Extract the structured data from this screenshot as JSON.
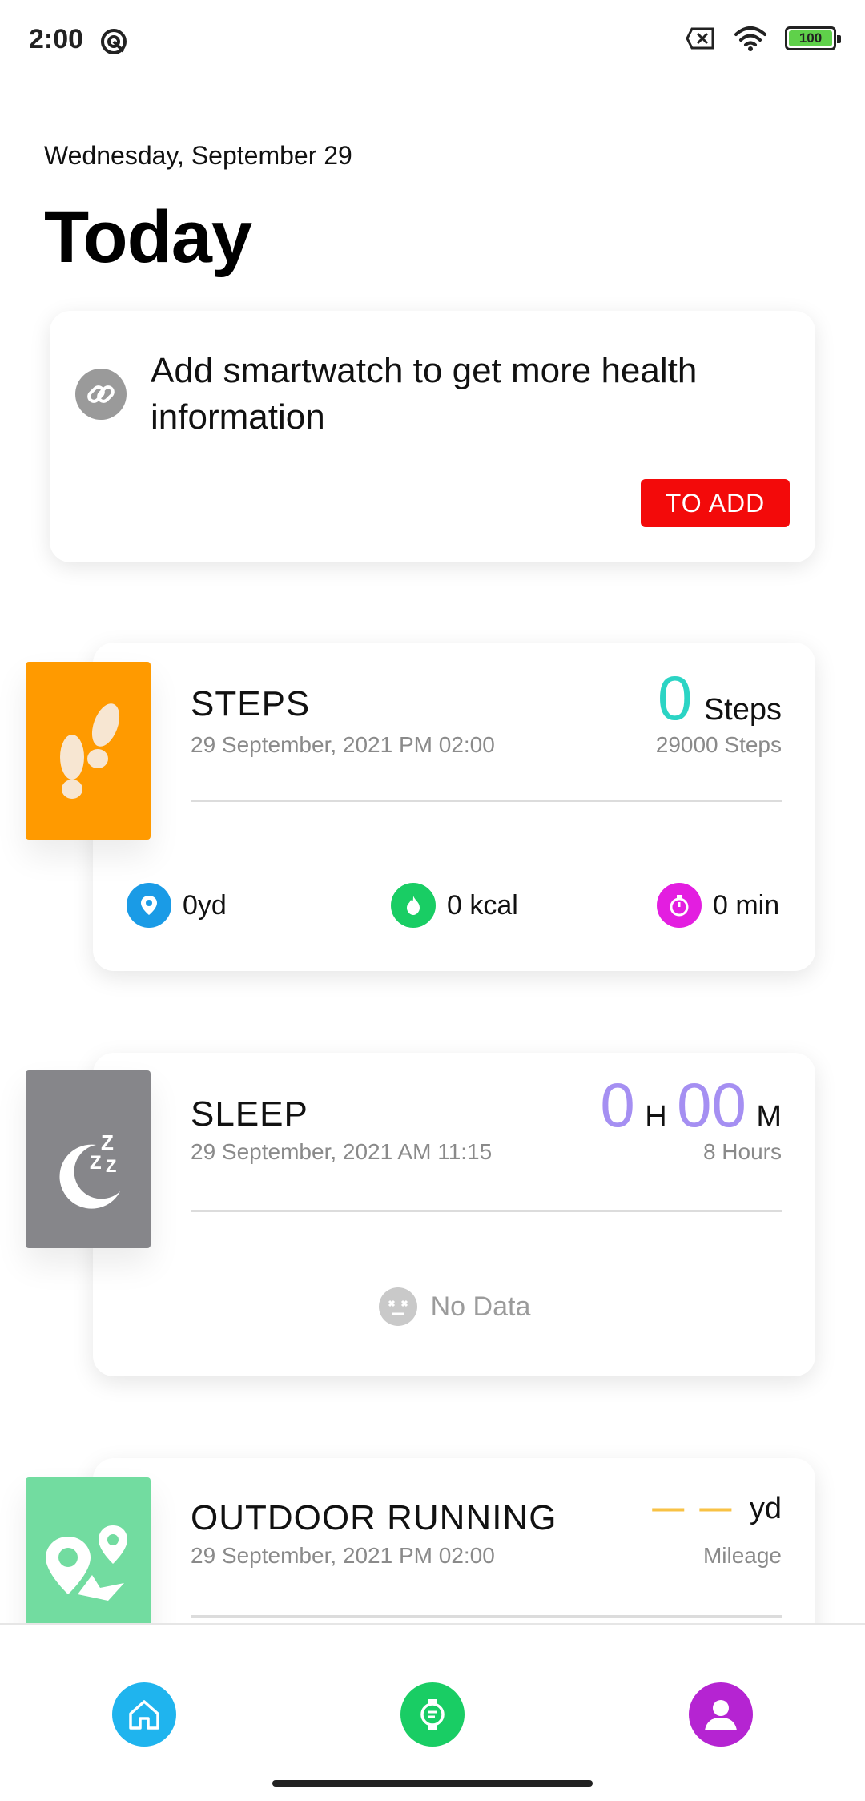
{
  "status_bar": {
    "time": "2:00",
    "battery": "100"
  },
  "header": {
    "date": "Wednesday, September 29",
    "title": "Today"
  },
  "add_card": {
    "message": "Add smartwatch to get more health information",
    "button_label": "TO ADD"
  },
  "steps": {
    "title": "STEPS",
    "timestamp": "29 September, 2021 PM 02:00",
    "value": "0",
    "unit": "Steps",
    "goal": "29000 Steps",
    "distance": "0yd",
    "calories": "0 kcal",
    "duration": "0 min",
    "accent": "#2bd4c4",
    "tile_color": "#ff9a00"
  },
  "sleep": {
    "title": "SLEEP",
    "timestamp": "29 September, 2021 AM 11:15",
    "hours": "0",
    "hours_unit": "H",
    "minutes": "00",
    "minutes_unit": "M",
    "goal": "8 Hours",
    "no_data": "No Data",
    "accent": "#a58ff2",
    "tile_color": "#86868a"
  },
  "running": {
    "title": "OUTDOOR RUNNING",
    "timestamp": "29 September, 2021 PM 02:00",
    "value": "— —",
    "unit": "yd",
    "label": "Mileage",
    "accent": "#f8c244",
    "tile_color": "#72dca0"
  },
  "nav": {
    "home_color": "#1fb4ee",
    "device_color": "#19cd64",
    "profile_color": "#b524d2"
  }
}
